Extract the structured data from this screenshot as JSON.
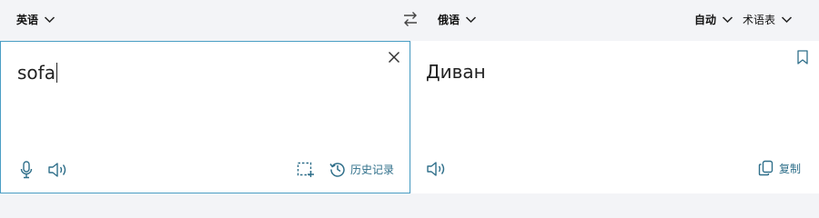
{
  "toolbar": {
    "source_language": "英语",
    "target_language": "俄语",
    "tone": "自动",
    "glossary": "术语表"
  },
  "source": {
    "text": "sofa"
  },
  "target": {
    "text": "Диван"
  },
  "source_actions": {
    "history_label": "历史记录"
  },
  "target_actions": {
    "copy_label": "复制"
  },
  "colors": {
    "accent": "#2f6f8a",
    "focus_border": "#4a9ec4",
    "toolbar_bg": "#f3f4f7"
  },
  "icons": [
    "chevron-down-icon",
    "swap-icon",
    "close-icon",
    "bookmark-icon",
    "microphone-icon",
    "speaker-icon",
    "screenshot-crop-icon",
    "history-icon",
    "copy-icon"
  ]
}
